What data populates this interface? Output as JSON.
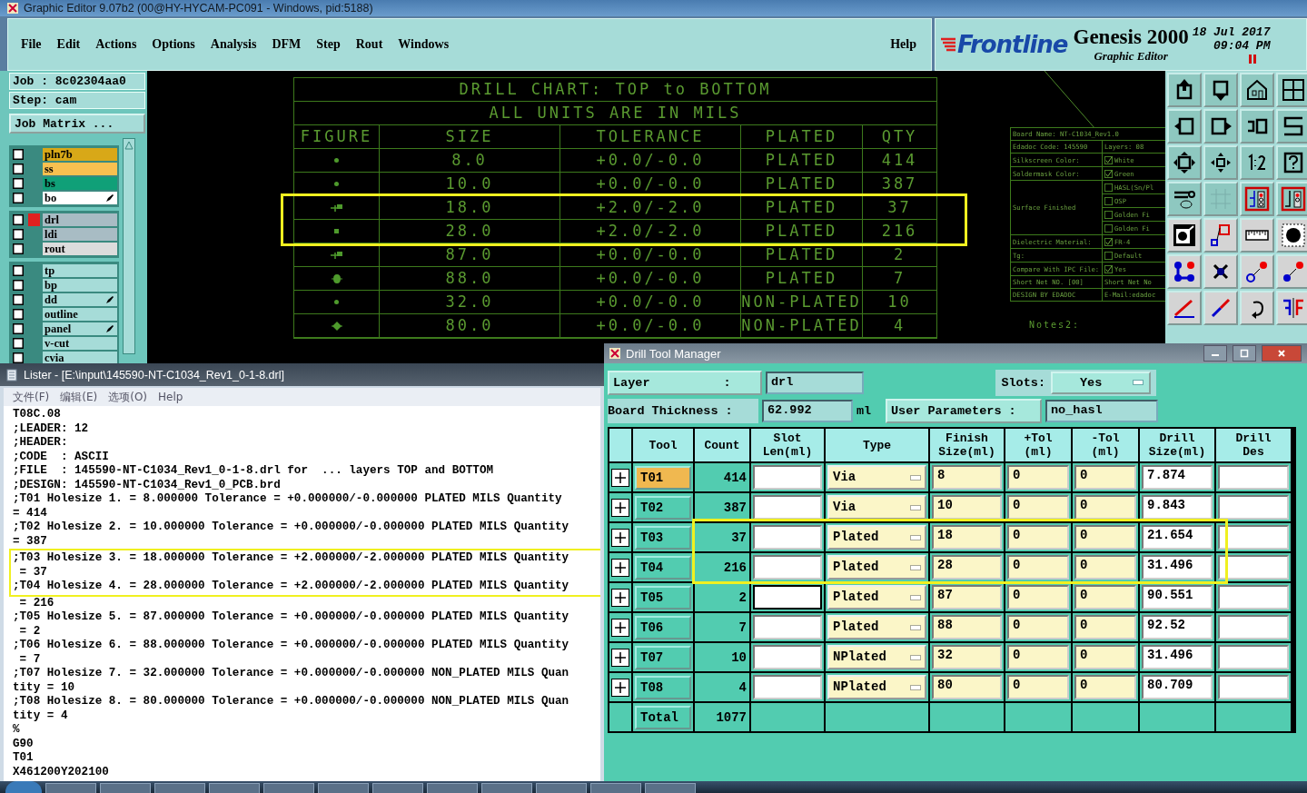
{
  "main_window": {
    "title": "Graphic Editor 9.07b2 (00@HY-HYCAM-PC091 - Windows, pid:5188)",
    "menu": [
      "File",
      "Edit",
      "Actions",
      "Options",
      "Analysis",
      "DFM",
      "Step",
      "Rout",
      "Windows"
    ],
    "help": "Help"
  },
  "brand": {
    "logo": "Frontline",
    "product": "Genesis 2000",
    "subtitle": "Graphic Editor",
    "date": "18 Jul 2017",
    "time": "09:04 PM"
  },
  "job_panel": {
    "job": "Job : 8c02304aa0",
    "step": "Step: cam",
    "matrix_button": "Job Matrix ..."
  },
  "layer_groups": [
    [
      {
        "name": "pln7b",
        "color": "#d8a818",
        "affected": false,
        "pen": false,
        "checked": false
      },
      {
        "name": "ss",
        "color": "#f8c050",
        "affected": false,
        "pen": false,
        "checked": false
      },
      {
        "name": "bs",
        "color": "#10a078",
        "affected": false,
        "pen": false,
        "checked": false
      },
      {
        "name": "bo",
        "color": "#ffffff",
        "affected": false,
        "pen": true,
        "checked": false
      }
    ],
    [
      {
        "name": "drl",
        "color": "#a8bcc4",
        "affected": true,
        "pen": false,
        "checked": false
      },
      {
        "name": "ldi",
        "color": "#a8bcc4",
        "affected": false,
        "pen": false,
        "checked": false
      },
      {
        "name": "rout",
        "color": "#dcdcdc",
        "affected": false,
        "pen": false,
        "checked": false
      }
    ],
    [
      {
        "name": "tp",
        "color": "#a6dcd8",
        "affected": false,
        "pen": false,
        "checked": false
      },
      {
        "name": "bp",
        "color": "#a6dcd8",
        "affected": false,
        "pen": false,
        "checked": false
      },
      {
        "name": "dd",
        "color": "#a6dcd8",
        "affected": false,
        "pen": true,
        "checked": false
      },
      {
        "name": "outline",
        "color": "#a6dcd8",
        "affected": false,
        "pen": false,
        "checked": false
      },
      {
        "name": "panel",
        "color": "#a6dcd8",
        "affected": false,
        "pen": true,
        "checked": false
      },
      {
        "name": "v-cut",
        "color": "#a6dcd8",
        "affected": false,
        "pen": false,
        "checked": false
      },
      {
        "name": "cvia",
        "color": "#a6dcd8",
        "affected": false,
        "pen": false,
        "checked": false
      }
    ]
  ],
  "drill_chart": {
    "title": "DRILL CHART: TOP to BOTTOM",
    "subtitle": "ALL UNITS ARE IN MILS",
    "columns": [
      "FIGURE",
      "SIZE",
      "TOLERANCE",
      "PLATED",
      "QTY"
    ],
    "rows": [
      {
        "kind": "dot",
        "size": "8.0",
        "tolerance": "+0.0/-0.0",
        "plated": "PLATED",
        "qty": "414",
        "highlighted": false
      },
      {
        "kind": "dot",
        "size": "10.0",
        "tolerance": "+0.0/-0.0",
        "plated": "PLATED",
        "qty": "387",
        "highlighted": false
      },
      {
        "kind": "flag",
        "size": "18.0",
        "tolerance": "+2.0/-2.0",
        "plated": "PLATED",
        "qty": "37",
        "highlighted": true
      },
      {
        "kind": "square",
        "size": "28.0",
        "tolerance": "+2.0/-2.0",
        "plated": "PLATED",
        "qty": "216",
        "highlighted": true
      },
      {
        "kind": "flag",
        "size": "87.0",
        "tolerance": "+0.0/-0.0",
        "plated": "PLATED",
        "qty": "2",
        "highlighted": false
      },
      {
        "kind": "blob",
        "size": "88.0",
        "tolerance": "+0.0/-0.0",
        "plated": "PLATED",
        "qty": "7",
        "highlighted": false
      },
      {
        "kind": "dot",
        "size": "32.0",
        "tolerance": "+0.0/-0.0",
        "plated": "NON-PLATED",
        "qty": "10",
        "highlighted": false
      },
      {
        "kind": "diamond",
        "size": "80.0",
        "tolerance": "+0.0/-0.0",
        "plated": "NON-PLATED",
        "qty": "4",
        "highlighted": false
      }
    ]
  },
  "board_notes": {
    "rows": [
      {
        "kind": "span",
        "label": "Board Name: NT-C1034_Rev1.0"
      },
      {
        "kind": "value",
        "label": "Edadoc Code: 145590",
        "value": "Layers: 08"
      },
      {
        "kind": "options",
        "label": "Silkscreen Color:",
        "options": [
          {
            "text": "White",
            "checked": true
          }
        ]
      },
      {
        "kind": "options",
        "label": "Soldermask Color:",
        "options": [
          {
            "text": "Green",
            "checked": true
          }
        ]
      },
      {
        "kind": "options",
        "label": "Surface Finished",
        "options": [
          {
            "text": "HASL(Sn/Pl",
            "checked": false
          },
          {
            "text": "OSP",
            "checked": false
          },
          {
            "text": "Golden Fi",
            "checked": false
          },
          {
            "text": "Golden Fi",
            "checked": false
          }
        ]
      },
      {
        "kind": "options",
        "label": "Dielectric Material:",
        "options": [
          {
            "text": "FR-4",
            "checked": true
          }
        ]
      },
      {
        "kind": "options",
        "label": "Tg:",
        "options": [
          {
            "text": "Default",
            "checked": false
          }
        ]
      },
      {
        "kind": "options",
        "label": "Compare With IPC File:",
        "options": [
          {
            "text": "Yes",
            "checked": true
          }
        ]
      },
      {
        "kind": "value",
        "label": "Short Net NO. [00]",
        "value": "Short Net No"
      },
      {
        "kind": "value",
        "label": "DESIGN BY EDADOC",
        "value": "E-Mail:edadoc"
      }
    ],
    "notes": "Notes2:"
  },
  "lister": {
    "title": "Lister - [E:\\input\\145590-NT-C1034_Rev1_0-1-8.drl]",
    "menu": [
      "文件(F)",
      "编辑(E)",
      "选项(O)",
      "Help"
    ],
    "lines": [
      {
        "text": "T08C.08",
        "highlighted": false
      },
      {
        "text": ";LEADER: 12",
        "highlighted": false
      },
      {
        "text": ";HEADER:",
        "highlighted": false
      },
      {
        "text": ";CODE  : ASCII",
        "highlighted": false
      },
      {
        "text": ";FILE  : 145590-NT-C1034_Rev1_0-1-8.drl for  ... layers TOP and BOTTOM",
        "highlighted": false
      },
      {
        "text": ";DESIGN: 145590-NT-C1034_Rev1_0_PCB.brd",
        "highlighted": false
      },
      {
        "text": ";T01 Holesize 1. = 8.000000 Tolerance = +0.000000/-0.000000 PLATED MILS Quantity",
        "highlighted": false
      },
      {
        "text": "= 414",
        "highlighted": false
      },
      {
        "text": ";T02 Holesize 2. = 10.000000 Tolerance = +0.000000/-0.000000 PLATED MILS Quantity",
        "highlighted": false
      },
      {
        "text": "= 387",
        "highlighted": false
      },
      {
        "text": ";T03 Holesize 3. = 18.000000 Tolerance = +2.000000/-2.000000 PLATED MILS Quantity",
        "highlighted": true
      },
      {
        "text": " = 37",
        "highlighted": true
      },
      {
        "text": ";T04 Holesize 4. = 28.000000 Tolerance = +2.000000/-2.000000 PLATED MILS Quantity",
        "highlighted": true
      },
      {
        "text": " = 216",
        "highlighted": false
      },
      {
        "text": ";T05 Holesize 5. = 87.000000 Tolerance = +0.000000/-0.000000 PLATED MILS Quantity",
        "highlighted": false
      },
      {
        "text": " = 2",
        "highlighted": false
      },
      {
        "text": ";T06 Holesize 6. = 88.000000 Tolerance = +0.000000/-0.000000 PLATED MILS Quantity",
        "highlighted": false
      },
      {
        "text": " = 7",
        "highlighted": false
      },
      {
        "text": ";T07 Holesize 7. = 32.000000 Tolerance = +0.000000/-0.000000 NON_PLATED MILS Quan",
        "highlighted": false
      },
      {
        "text": "tity = 10",
        "highlighted": false
      },
      {
        "text": ";T08 Holesize 8. = 80.000000 Tolerance = +0.000000/-0.000000 NON_PLATED MILS Quan",
        "highlighted": false
      },
      {
        "text": "tity = 4",
        "highlighted": false
      },
      {
        "text": "%",
        "highlighted": false
      },
      {
        "text": "G90",
        "highlighted": false
      },
      {
        "text": "T01",
        "highlighted": false
      },
      {
        "text": "X461200Y202100",
        "highlighted": false
      }
    ]
  },
  "tool_manager": {
    "title": "Drill Tool Manager",
    "layer_label": "Layer          :",
    "layer": "drl",
    "slots_label": "Slots:",
    "slots": "Yes",
    "thickness_label": "Board Thickness :",
    "thickness": "62.992",
    "unit": "ml",
    "user_params_button": "User Parameters :",
    "user_params": "no_hasl",
    "columns": [
      "Tool",
      "Count",
      "Slot\nLen(ml)",
      "Type",
      "Finish\nSize(ml)",
      "+Tol\n(ml)",
      "-Tol\n(ml)",
      "Drill\nSize(ml)",
      "Drill\nDes"
    ],
    "tools": [
      {
        "tool": "T01",
        "count": "414",
        "type": "Via",
        "finish": "8",
        "plus_tol": "0",
        "minus_tol": "0",
        "drill_size": "7.874",
        "selected": true,
        "focused": false,
        "highlighted": false
      },
      {
        "tool": "T02",
        "count": "387",
        "type": "Via",
        "finish": "10",
        "plus_tol": "0",
        "minus_tol": "0",
        "drill_size": "9.843",
        "selected": false,
        "focused": false,
        "highlighted": false
      },
      {
        "tool": "T03",
        "count": "37",
        "type": "Plated",
        "finish": "18",
        "plus_tol": "0",
        "minus_tol": "0",
        "drill_size": "21.654",
        "selected": false,
        "focused": false,
        "highlighted": true
      },
      {
        "tool": "T04",
        "count": "216",
        "type": "Plated",
        "finish": "28",
        "plus_tol": "0",
        "minus_tol": "0",
        "drill_size": "31.496",
        "selected": false,
        "focused": false,
        "highlighted": true
      },
      {
        "tool": "T05",
        "count": "2",
        "type": "Plated",
        "finish": "87",
        "plus_tol": "0",
        "minus_tol": "0",
        "drill_size": "90.551",
        "selected": false,
        "focused": true,
        "highlighted": false
      },
      {
        "tool": "T06",
        "count": "7",
        "type": "Plated",
        "finish": "88",
        "plus_tol": "0",
        "minus_tol": "0",
        "drill_size": "92.52",
        "selected": false,
        "focused": false,
        "highlighted": false
      },
      {
        "tool": "T07",
        "count": "10",
        "type": "NPlated",
        "finish": "32",
        "plus_tol": "0",
        "minus_tol": "0",
        "drill_size": "31.496",
        "selected": false,
        "focused": false,
        "highlighted": false
      },
      {
        "tool": "T08",
        "count": "4",
        "type": "NPlated",
        "finish": "80",
        "plus_tol": "0",
        "minus_tol": "0",
        "drill_size": "80.709",
        "selected": false,
        "focused": false,
        "highlighted": false
      }
    ],
    "total_label": "Total",
    "total": "1077"
  }
}
